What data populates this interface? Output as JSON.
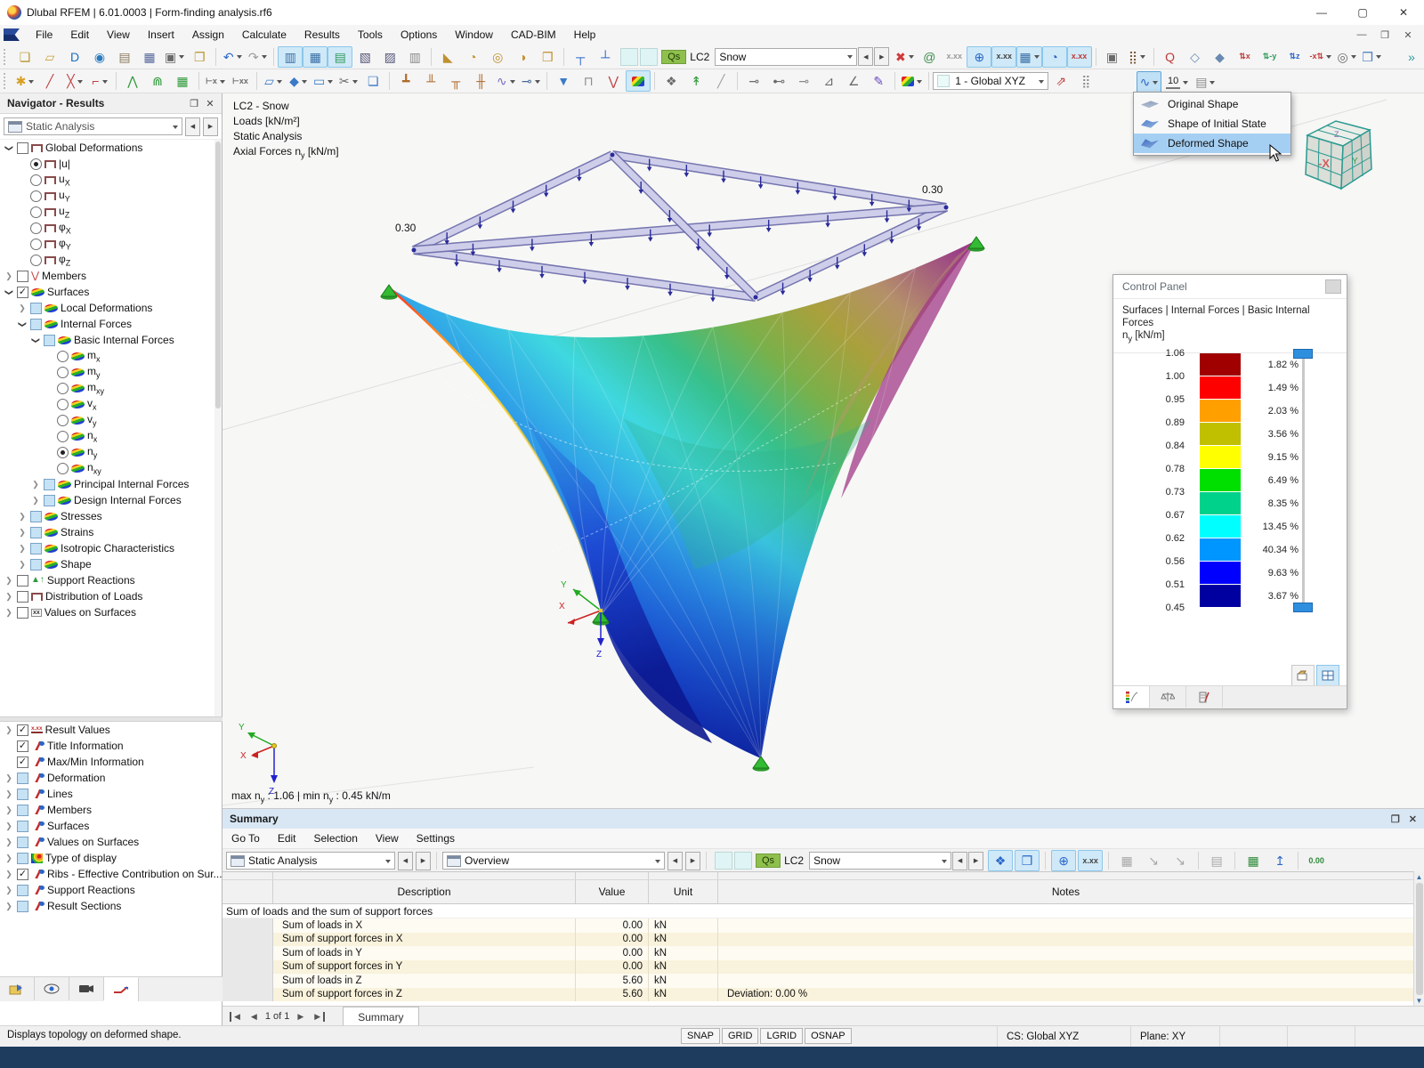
{
  "window": {
    "title": "Dlubal RFEM | 6.01.0003 | Form-finding analysis.rf6"
  },
  "menubar": {
    "items": [
      "File",
      "Edit",
      "View",
      "Insert",
      "Assign",
      "Calculate",
      "Results",
      "Tools",
      "Options",
      "Window",
      "CAD-BIM",
      "Help"
    ]
  },
  "toolbar1": {
    "lc": {
      "badge": "Qs",
      "lc": "LC2",
      "name": "Snow"
    },
    "icons": [
      {
        "grip": true
      },
      {
        "n": "new-model-icon",
        "g": "❏",
        "c": "#b8962e"
      },
      {
        "n": "open-file-icon",
        "g": "▱",
        "c": "#c8a23a"
      },
      {
        "n": "dlubal-center-icon",
        "g": "D",
        "c": "#1a6fc4"
      },
      {
        "n": "network-icon",
        "g": "◉",
        "c": "#2a7ac0"
      },
      {
        "n": "model-image-icon",
        "g": "▤",
        "c": "#8a7a5a"
      },
      {
        "n": "save-icon",
        "g": "▦",
        "c": "#56699b"
      },
      {
        "n": "print-icon",
        "g": "▣",
        "c": "#6a6a6a",
        "dd": true
      },
      {
        "n": "printout-report-icon",
        "g": "❐",
        "c": "#b8962e"
      },
      {
        "sep": true
      },
      {
        "n": "undo-icon",
        "g": "↶",
        "c": "#2a66c8",
        "dd": true
      },
      {
        "n": "redo-icon",
        "g": "↷",
        "c": "#9a9aa0",
        "dd": true
      },
      {
        "sep": true
      },
      {
        "n": "table-results-icon",
        "g": "▥",
        "c": "#3a6ea5",
        "hl": true
      },
      {
        "n": "table-grid-icon",
        "g": "▦",
        "c": "#3a6ea5",
        "hl": true
      },
      {
        "n": "table-filtered-icon",
        "g": "▤",
        "c": "#2f9a5a",
        "hl": true
      },
      {
        "n": "table-script-icon",
        "g": "▧",
        "c": "#55557a"
      },
      {
        "n": "table-sc-icon",
        "g": "▨",
        "c": "#55557a"
      },
      {
        "n": "table-plain-icon",
        "g": "▥",
        "c": "#8a8a8a"
      },
      {
        "sep": true
      },
      {
        "n": "select-polygon-icon",
        "g": "◣",
        "c": "#c09030"
      },
      {
        "n": "select-circle-icon",
        "g": "◔",
        "c": "#c09030"
      },
      {
        "n": "select-ring-icon",
        "g": "◎",
        "c": "#c09030"
      },
      {
        "n": "select-sector-icon",
        "g": "◑",
        "c": "#c09030"
      },
      {
        "n": "select-table-icon",
        "g": "❒",
        "c": "#c09030"
      },
      {
        "sep": true
      },
      {
        "n": "insert-node-top-icon",
        "g": "┬",
        "c": "#2a66c8"
      },
      {
        "n": "insert-node-bottom-icon",
        "g": "┴",
        "c": "#2a66c8"
      },
      {
        "lc": true
      },
      {
        "n": "filter-loads-icon",
        "g": "✖",
        "c": "#d03a3a",
        "dd": true
      },
      {
        "n": "show-loads-icon",
        "g": "@",
        "c": "#3a8a4a"
      },
      {
        "n": "load-values-icon",
        "t": "x.xx",
        "c": "#9a9a9a"
      },
      {
        "n": "show-results-icon",
        "g": "⊕",
        "c": "#2a66c8",
        "hl": true
      },
      {
        "n": "result-values-icon",
        "t": "x.xx",
        "c": "#444444",
        "hl": true
      },
      {
        "n": "result-table-icon",
        "g": "▦",
        "c": "#3a6ea5",
        "hl": true,
        "dd": true
      },
      {
        "n": "result-diagram-icon",
        "g": "◔",
        "c": "#2a66c8",
        "hl": true
      },
      {
        "n": "result-xxx-icon",
        "t": "x.xx",
        "c": "#c03a3a",
        "hl": true
      },
      {
        "sep": true
      },
      {
        "n": "print-graphic-icon",
        "g": "▣",
        "c": "#6a6a6a"
      },
      {
        "n": "calculator-icon",
        "g": "⣿",
        "c": "#7a5a3a",
        "dd": true
      },
      {
        "sep": true
      },
      {
        "n": "zoom-cancel-icon",
        "g": "Q",
        "c": "#c03a3a"
      },
      {
        "n": "isometric-view-icon",
        "g": "◇",
        "c": "#6a8ab0"
      },
      {
        "n": "edit-view-icon",
        "g": "◆",
        "c": "#6a8ab0"
      },
      {
        "n": "view-x-icon",
        "t": "⇅x",
        "c": "#c03a3a"
      },
      {
        "n": "view-minus-y-icon",
        "t": "⇅-y",
        "c": "#2f9a5a"
      },
      {
        "n": "view-z-icon",
        "t": "⇅z",
        "c": "#2a66c8"
      },
      {
        "n": "view-minus-x-icon",
        "t": "-x⇅",
        "c": "#c03a3a",
        "dd": true
      },
      {
        "n": "zoom-detail-icon",
        "g": "◎",
        "c": "#6a6a6a",
        "dd": true
      },
      {
        "n": "visibility-cubes-icon",
        "g": "❒",
        "c": "#4a7ac0",
        "dd": true
      },
      {
        "spacer": true
      },
      {
        "n": "more-toolbar-icon",
        "g": "»",
        "c": "#2a9aa0"
      }
    ]
  },
  "toolbar2": {
    "cs_combo": "1 - Global XYZ",
    "scale_factor": "10",
    "icons": [
      {
        "grip": true
      },
      {
        "n": "new-node-icon",
        "g": "✱",
        "c": "#d8a020",
        "dd": true
      },
      {
        "n": "new-line-icon",
        "g": "╱",
        "c": "#c04040"
      },
      {
        "n": "new-line-type-icon",
        "g": "╳",
        "c": "#c04040",
        "dd": true
      },
      {
        "n": "new-polyline-icon",
        "g": "⌐",
        "c": "#c04040",
        "dd": true
      },
      {
        "sep": true
      },
      {
        "n": "new-member-icon",
        "g": "⋀",
        "c": "#2f9a3a"
      },
      {
        "n": "new-member-set-icon",
        "g": "⋒",
        "c": "#2f9a3a"
      },
      {
        "n": "member-table-icon",
        "g": "▦",
        "c": "#2f9a3a"
      },
      {
        "sep": true
      },
      {
        "n": "dimension-x-icon",
        "t": "⊢x",
        "c": "#6a6a6a",
        "dd": true
      },
      {
        "n": "dimension-xx-icon",
        "t": "⊢xx",
        "c": "#6a6a6a"
      },
      {
        "sep": true
      },
      {
        "n": "new-surface-icon",
        "g": "▱",
        "c": "#3a7ac8",
        "dd": true
      },
      {
        "n": "new-solid-icon",
        "g": "◆",
        "c": "#3a7ac8",
        "dd": true
      },
      {
        "n": "new-opening-icon",
        "g": "▭",
        "c": "#3a7ac8",
        "dd": true
      },
      {
        "n": "new-section-icon",
        "g": "✂",
        "c": "#6a6a6a",
        "dd": true
      },
      {
        "n": "new-cut-icon",
        "g": "❏",
        "c": "#3a7ac8"
      },
      {
        "sep": true
      },
      {
        "n": "nodal-support-icon",
        "g": "┻",
        "c": "#b06a2a"
      },
      {
        "n": "member-hinge-icon",
        "g": "╨",
        "c": "#b06a2a"
      },
      {
        "n": "member-support-icon",
        "g": "╥",
        "c": "#b06a2a"
      },
      {
        "n": "surface-support-icon",
        "g": "╫",
        "c": "#b06a2a"
      },
      {
        "n": "member-release-icon",
        "g": "∿",
        "c": "#7a6ac0",
        "dd": true
      },
      {
        "n": "member-nonlinearity-icon",
        "g": "⊸",
        "c": "#4a6a9a",
        "dd": true
      },
      {
        "sep": true
      },
      {
        "n": "filter-funnel-icon",
        "g": "▼",
        "c": "#3a7ac8"
      },
      {
        "n": "member-diagram-frame-icon",
        "g": "⊓",
        "c": "#8a8a8a"
      },
      {
        "n": "member-diagram-icon",
        "g": "⋁",
        "c": "#c04040"
      },
      {
        "n": "surface-results-icon",
        "cls": "rainbow",
        "hl": true
      },
      {
        "sep": true
      },
      {
        "n": "iso-values-icon",
        "g": "❖",
        "c": "#6a6a6a"
      },
      {
        "n": "walk-through-icon",
        "g": "↟",
        "c": "#2f9a3a"
      },
      {
        "n": "slope-icon",
        "g": "╱",
        "c": "#a0a0a0"
      },
      {
        "sep": true
      },
      {
        "n": "result-section-1-icon",
        "g": "⊸",
        "c": "#6a6a6a"
      },
      {
        "n": "result-section-2-icon",
        "g": "⊷",
        "c": "#6a6a6a"
      },
      {
        "n": "result-section-3-icon",
        "g": "⊸",
        "c": "#8a8a8a"
      },
      {
        "n": "result-section-4-icon",
        "g": "⊿",
        "c": "#6a6a6a"
      },
      {
        "n": "result-section-5-icon",
        "g": "∠",
        "c": "#6a6a6a"
      },
      {
        "n": "smooth-results-icon",
        "g": "✎",
        "c": "#6a4ac0"
      },
      {
        "sep": true
      },
      {
        "n": "color-scale-icon",
        "cls": "rainbow",
        "dd": true
      },
      {
        "sep": true
      },
      {
        "cs": true
      },
      {
        "n": "ucs-icon",
        "g": "⇗",
        "c": "#c04040"
      },
      {
        "n": "grid-points-icon",
        "g": "⣿",
        "c": "#8a8a8a"
      }
    ],
    "right_icons": [
      {
        "n": "deformed-shape-button",
        "g": "∿",
        "c": "#2a66c8",
        "pressed": true,
        "dd": true
      },
      {
        "n": "display-factor-button",
        "ruler": true,
        "dd": true
      },
      {
        "n": "results-on-objects-button",
        "g": "▤",
        "c": "#8a8a8a",
        "dd": true
      }
    ]
  },
  "shape_menu": {
    "items": [
      {
        "label": "Original Shape"
      },
      {
        "label": "Shape of Initial State"
      },
      {
        "label": "Deformed Shape",
        "selected": true
      }
    ]
  },
  "navigator": {
    "title": "Navigator - Results",
    "combo": "Static Analysis",
    "tree": [
      {
        "i": 0,
        "e": "v",
        "c": "un",
        "ic": "frame",
        "l": "Global Deformations"
      },
      {
        "i": 1,
        "r": "on",
        "ic": "frame",
        "l": "|u|"
      },
      {
        "i": 1,
        "r": "off",
        "ic": "frame",
        "l": "u",
        "s": "X"
      },
      {
        "i": 1,
        "r": "off",
        "ic": "frame",
        "l": "u",
        "s": "Y"
      },
      {
        "i": 1,
        "r": "off",
        "ic": "frame",
        "l": "u",
        "s": "Z"
      },
      {
        "i": 1,
        "r": "off",
        "ic": "frame",
        "l": "φ",
        "s": "X"
      },
      {
        "i": 1,
        "r": "off",
        "ic": "frame",
        "l": "φ",
        "s": "Y"
      },
      {
        "i": 1,
        "r": "off",
        "ic": "frame",
        "l": "φ",
        "s": "Z"
      },
      {
        "i": 0,
        "e": ">",
        "c": "un",
        "ic": "member",
        "l": "Members"
      },
      {
        "i": 0,
        "e": "v",
        "c": "ck",
        "ic": "surface",
        "l": "Surfaces"
      },
      {
        "i": 1,
        "e": ">",
        "c": "pa",
        "ic": "surface",
        "l": "Local Deformations"
      },
      {
        "i": 1,
        "e": "v",
        "c": "pa",
        "ic": "surface",
        "l": "Internal Forces"
      },
      {
        "i": 2,
        "e": "v",
        "c": "pa",
        "ic": "surface",
        "l": "Basic Internal Forces"
      },
      {
        "i": 3,
        "r": "off",
        "ic": "surface",
        "l": "m",
        "s": "x"
      },
      {
        "i": 3,
        "r": "off",
        "ic": "surface",
        "l": "m",
        "s": "y"
      },
      {
        "i": 3,
        "r": "off",
        "ic": "surface",
        "l": "m",
        "s": "xy"
      },
      {
        "i": 3,
        "r": "off",
        "ic": "surface",
        "l": "v",
        "s": "x"
      },
      {
        "i": 3,
        "r": "off",
        "ic": "surface",
        "l": "v",
        "s": "y"
      },
      {
        "i": 3,
        "r": "off",
        "ic": "surface",
        "l": "n",
        "s": "x"
      },
      {
        "i": 3,
        "r": "on",
        "ic": "surface",
        "l": "n",
        "s": "y"
      },
      {
        "i": 3,
        "r": "off",
        "ic": "surface",
        "l": "n",
        "s": "xy"
      },
      {
        "i": 2,
        "e": ">",
        "c": "pa",
        "ic": "surface",
        "l": "Principal Internal Forces"
      },
      {
        "i": 2,
        "e": ">",
        "c": "pa",
        "ic": "surface",
        "l": "Design Internal Forces"
      },
      {
        "i": 1,
        "e": ">",
        "c": "pa",
        "ic": "surface",
        "l": "Stresses"
      },
      {
        "i": 1,
        "e": ">",
        "c": "pa",
        "ic": "surface",
        "l": "Strains"
      },
      {
        "i": 1,
        "e": ">",
        "c": "pa",
        "ic": "surface",
        "l": "Isotropic Characteristics"
      },
      {
        "i": 1,
        "e": ">",
        "c": "pa",
        "ic": "surface",
        "l": "Shape"
      },
      {
        "i": 0,
        "e": ">",
        "c": "un",
        "ic": "support",
        "l": "Support Reactions"
      },
      {
        "i": 0,
        "e": ">",
        "c": "un",
        "ic": "frame",
        "l": "Distribution of Loads"
      },
      {
        "i": 0,
        "e": ">",
        "c": "un",
        "ic": "values",
        "l": "Values on Surfaces"
      }
    ],
    "display_list": [
      {
        "e": 1,
        "c": "ck",
        "ic": "xxx",
        "l": "Result Values"
      },
      {
        "e": 0,
        "c": "ck",
        "ic": "flag",
        "l": "Title Information"
      },
      {
        "e": 0,
        "c": "ck",
        "ic": "flag",
        "l": "Max/Min Information"
      },
      {
        "e": 1,
        "c": "pa",
        "ic": "flag",
        "l": "Deformation"
      },
      {
        "e": 1,
        "c": "pa",
        "ic": "flag",
        "l": "Lines"
      },
      {
        "e": 1,
        "c": "pa",
        "ic": "flag",
        "l": "Members"
      },
      {
        "e": 1,
        "c": "pa",
        "ic": "flag",
        "l": "Surfaces"
      },
      {
        "e": 1,
        "c": "pa",
        "ic": "flag",
        "l": "Values on Surfaces"
      },
      {
        "e": 1,
        "c": "pa",
        "ic": "rainbow",
        "l": "Type of display"
      },
      {
        "e": 1,
        "c": "ck",
        "ic": "flag",
        "l": "Ribs - Effective Contribution on Sur..."
      },
      {
        "e": 1,
        "c": "pa",
        "ic": "flag",
        "l": "Support Reactions"
      },
      {
        "e": 1,
        "c": "pa",
        "ic": "flag",
        "l": "Result Sections"
      }
    ]
  },
  "viewport": {
    "overlay": {
      "l1": "LC2 - Snow",
      "l2": "Loads [kN/m²]",
      "l3": "Static Analysis",
      "l4a": "Axial Forces n",
      "l4sub": "y",
      "l4b": " [kN/m]"
    },
    "loads": {
      "left": "0.30",
      "right": "0.30"
    },
    "axes": {
      "x": "X",
      "y": "Y",
      "z": "Z"
    },
    "cube_label": "-X",
    "maxmin": {
      "a": "max n",
      "asub": "y",
      "b": " : 1.06 | min n",
      "bsub": "y",
      "c": " : 0.45 kN/m"
    }
  },
  "control_panel": {
    "title": "Control Panel",
    "header_line1": "Surfaces | Internal Forces | Basic Internal Forces",
    "header2a": "n",
    "header2sub": "y",
    "header2b": " [kN/m]",
    "values": [
      "1.06",
      "1.00",
      "0.95",
      "0.89",
      "0.84",
      "0.78",
      "0.73",
      "0.67",
      "0.62",
      "0.56",
      "0.51",
      "0.45"
    ],
    "colors": [
      "#A00000",
      "#FF0000",
      "#FFA000",
      "#C0C000",
      "#FFFF00",
      "#00E000",
      "#00D28C",
      "#00FFFF",
      "#0096FF",
      "#0000FF",
      "#0000A0"
    ],
    "percents": [
      "1.82 %",
      "1.49 %",
      "2.03 %",
      "3.56 %",
      "9.15 %",
      "6.49 %",
      "8.35 %",
      "13.45 %",
      "40.34 %",
      "9.63 %",
      "3.67 %"
    ]
  },
  "summary": {
    "title": "Summary",
    "menus": [
      "Go To",
      "Edit",
      "Selection",
      "View",
      "Settings"
    ],
    "combo1": "Static Analysis",
    "combo2": "Overview",
    "lc": {
      "badge": "Qs",
      "lc": "LC2",
      "name": "Snow"
    },
    "icons": [
      {
        "n": "select-in-graphic-icon",
        "g": "❖",
        "c": "#2a66c8",
        "hl": true
      },
      {
        "n": "select-rubber-icon",
        "g": "❒",
        "c": "#2a66c8",
        "hl": true
      },
      {
        "sep": true
      },
      {
        "n": "show-results-icon",
        "g": "⊕",
        "c": "#2a66c8",
        "hl": true
      },
      {
        "n": "show-values-icon",
        "t": "x.xx",
        "c": "#444444",
        "hl": true
      },
      {
        "sep": true
      },
      {
        "n": "table-view-icon",
        "g": "▦",
        "c": "#a8a8a8"
      },
      {
        "n": "diagram-one-icon",
        "g": "↘",
        "c": "#a8a8a8"
      },
      {
        "n": "diagram-two-icon",
        "g": "↘",
        "c": "#a8a8a8"
      },
      {
        "sep": true
      },
      {
        "n": "report-icon",
        "g": "▤",
        "c": "#a8a8a8"
      },
      {
        "sep": true
      },
      {
        "n": "excel-export-icon",
        "g": "▦",
        "c": "#2f8a3a"
      },
      {
        "n": "import-icon",
        "g": "↥",
        "c": "#2a66c8"
      },
      {
        "sep": true
      },
      {
        "n": "decimal-places-icon",
        "t": "0.00",
        "c": "#2f8a3a"
      }
    ],
    "table": {
      "headers": [
        "Description",
        "Value",
        "Unit",
        "Notes"
      ],
      "section": "Sum of loads and the sum of support forces",
      "rows": [
        [
          "Sum of loads in X",
          "0.00",
          "kN",
          ""
        ],
        [
          "Sum of support forces in X",
          "0.00",
          "kN",
          ""
        ],
        [
          "Sum of loads in Y",
          "0.00",
          "kN",
          ""
        ],
        [
          "Sum of support forces in Y",
          "0.00",
          "kN",
          ""
        ],
        [
          "Sum of loads in Z",
          "5.60",
          "kN",
          ""
        ],
        [
          "Sum of support forces in Z",
          "5.60",
          "kN",
          "Deviation: 0.00 %"
        ]
      ]
    },
    "pagination": "1 of 1",
    "tab": "Summary"
  },
  "statusbar": {
    "message": "Displays topology on deformed shape.",
    "toggles": [
      "SNAP",
      "GRID",
      "LGRID",
      "OSNAP"
    ],
    "cs": "CS: Global XYZ",
    "plane": "Plane: XY"
  }
}
